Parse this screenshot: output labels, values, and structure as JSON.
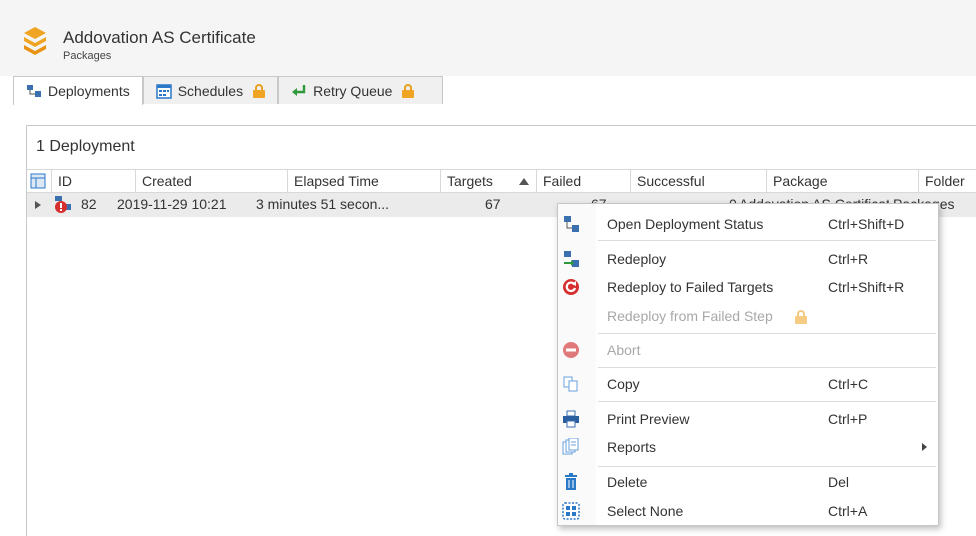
{
  "app": {
    "title": "Addovation AS Certificate",
    "subtitle": "Packages"
  },
  "tabs": [
    {
      "label": "Deployments",
      "icon": "network-icon",
      "locked": false
    },
    {
      "label": "Schedules",
      "icon": "calendar-icon",
      "locked": true
    },
    {
      "label": "Retry Queue",
      "icon": "return-arrow-icon",
      "locked": true
    }
  ],
  "panel": {
    "title": "1 Deployment"
  },
  "grid": {
    "columns": [
      "ID",
      "Created",
      "Elapsed Time",
      "Targets",
      "Failed",
      "Successful",
      "Package",
      "Folder"
    ],
    "sort_indicator": "ascending",
    "rows": [
      {
        "id": "82",
        "created": "2019-11-29 10:21",
        "elapsed": "3 minutes 51 secon...",
        "targets": "67",
        "failed": "67",
        "successful": "0",
        "package": "Addovation AS Certificate",
        "folder": "Packages",
        "status_icon": "deployment-error-icon"
      }
    ]
  },
  "context_menu": {
    "items": [
      {
        "label": "Open Deployment Status",
        "shortcut": "Ctrl+Shift+D",
        "icon": "network-icon",
        "enabled": true
      },
      {
        "label": "Redeploy",
        "shortcut": "Ctrl+R",
        "icon": "redeploy-icon",
        "enabled": true
      },
      {
        "label": "Redeploy to Failed Targets",
        "shortcut": "Ctrl+Shift+R",
        "icon": "redeploy-failed-icon",
        "enabled": true
      },
      {
        "label": "Redeploy from Failed Step",
        "shortcut": "",
        "icon": "lock-icon",
        "enabled": false
      },
      {
        "label": "Abort",
        "shortcut": "",
        "icon": "abort-icon",
        "enabled": false
      },
      {
        "label": "Copy",
        "shortcut": "Ctrl+C",
        "icon": "copy-icon",
        "enabled": true
      },
      {
        "label": "Print Preview",
        "shortcut": "Ctrl+P",
        "icon": "printer-icon",
        "enabled": true
      },
      {
        "label": "Reports",
        "shortcut": "",
        "icon": "reports-icon",
        "enabled": true,
        "submenu": true
      },
      {
        "label": "Delete",
        "shortcut": "Del",
        "icon": "trash-icon",
        "enabled": true
      },
      {
        "label": "Select None",
        "shortcut": "Ctrl+A",
        "icon": "select-none-icon",
        "enabled": true
      }
    ]
  },
  "colors": {
    "accent_orange": "#f0a423",
    "abort_red": "#e05050",
    "redeploy_red": "#d62f2f",
    "icon_blue": "#2a78c8",
    "lock": "#f0a423"
  }
}
